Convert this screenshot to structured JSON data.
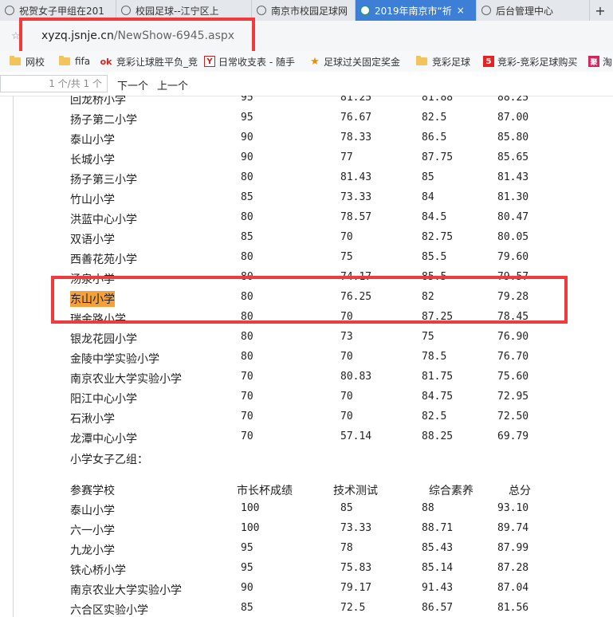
{
  "tabs": [
    {
      "label": "祝贺女子甲组在201",
      "active": false
    },
    {
      "label": "校园足球--江宁区上",
      "active": false
    },
    {
      "label": "南京市校园足球网",
      "active": false
    },
    {
      "label": "2019年南京市“祈",
      "active": true
    },
    {
      "label": "后台管理中心",
      "active": false
    }
  ],
  "new_tab_label": "+",
  "close_glyph": "×",
  "address": {
    "domain": "xyzq.jsnje.cn",
    "path": "/NewShow-6945.aspx"
  },
  "bookmarks": [
    {
      "label": "网校",
      "icon": "folder-icon"
    },
    {
      "label": "fifa",
      "icon": "folder-icon"
    },
    {
      "label": "竞彩让球胜平负_竞",
      "icon": "ok-icon"
    },
    {
      "label": "日常收支表 - 随手",
      "icon": "y-icon"
    },
    {
      "label": "足球过关固定奖金",
      "icon": "star-icon"
    },
    {
      "label": "竞彩足球",
      "icon": "folder-icon"
    },
    {
      "label": "竞彩-竞彩足球购买",
      "icon": "five-icon"
    },
    {
      "label": "淘",
      "icon": "ju-icon"
    }
  ],
  "bookmark_icon_glyphs": {
    "ok": "ok",
    "y": "Y",
    "star": "★",
    "five": "5",
    "ju": "聚"
  },
  "find": {
    "counter": "1 个/共 1 个",
    "next": "下一个",
    "prev": "上一个"
  },
  "rows_top": [
    {
      "school": "回龙桥小学",
      "a": "95",
      "b": "81.25",
      "c": "81.88",
      "d": "88.25"
    },
    {
      "school": "扬子第二小学",
      "a": "95",
      "b": "76.67",
      "c": "82.5",
      "d": "87.00"
    },
    {
      "school": "泰山小学",
      "a": "90",
      "b": "78.33",
      "c": "86.5",
      "d": "85.80"
    },
    {
      "school": "长城小学",
      "a": "90",
      "b": "77",
      "c": "87.75",
      "d": "85.65"
    },
    {
      "school": "扬子第三小学",
      "a": "80",
      "b": "81.43",
      "c": "85",
      "d": "81.43"
    },
    {
      "school": "竹山小学",
      "a": "85",
      "b": "73.33",
      "c": "84",
      "d": "81.30"
    },
    {
      "school": "洪蓝中心小学",
      "a": "80",
      "b": "78.57",
      "c": "84.5",
      "d": "80.47"
    },
    {
      "school": "双语小学",
      "a": "85",
      "b": "70",
      "c": "82.75",
      "d": "80.05"
    },
    {
      "school": "西善花苑小学",
      "a": "80",
      "b": "75",
      "c": "85.5",
      "d": "79.60"
    },
    {
      "school": "汤泉小学",
      "a": "80",
      "b": "74.17",
      "c": "85.5",
      "d": "79.57"
    },
    {
      "school": "东山小学",
      "a": "80",
      "b": "76.25",
      "c": "82",
      "d": "79.28"
    },
    {
      "school": "瑞金路小学",
      "a": "80",
      "b": "70",
      "c": "87.25",
      "d": "78.45"
    },
    {
      "school": "银龙花园小学",
      "a": "80",
      "b": "73",
      "c": "75",
      "d": "76.90"
    },
    {
      "school": "金陵中学实验小学",
      "a": "80",
      "b": "70",
      "c": "78.5",
      "d": "76.70"
    },
    {
      "school": "南京农业大学实验小学",
      "a": "70",
      "b": "80.83",
      "c": "81.75",
      "d": "75.60"
    },
    {
      "school": "阳江中心小学",
      "a": "70",
      "b": "70",
      "c": "84.75",
      "d": "72.95"
    },
    {
      "school": "石湫小学",
      "a": "70",
      "b": "70",
      "c": "82.5",
      "d": "72.50"
    },
    {
      "school": "龙潭中心小学",
      "a": "70",
      "b": "57.14",
      "c": "88.25",
      "d": "69.79"
    }
  ],
  "section_title": "小学女子乙组：",
  "headers": [
    "参赛学校",
    "市长杯成绩",
    "技术测试",
    "综合素养",
    "总分"
  ],
  "rows_bottom": [
    {
      "school": "泰山小学",
      "a": "100",
      "b": "85",
      "c": "88",
      "d": "93.10"
    },
    {
      "school": "六一小学",
      "a": "100",
      "b": "73.33",
      "c": "88.71",
      "d": "89.74"
    },
    {
      "school": "九龙小学",
      "a": "95",
      "b": "78",
      "c": "85.43",
      "d": "87.99"
    },
    {
      "school": "铁心桥小学",
      "a": "95",
      "b": "75.83",
      "c": "85.14",
      "d": "87.28"
    },
    {
      "school": "南京农业大学实验小学",
      "a": "90",
      "b": "79.17",
      "c": "91.43",
      "d": "87.04"
    },
    {
      "school": "六合区实验小学",
      "a": "85",
      "b": "72.5",
      "c": "86.57",
      "d": "81.56"
    }
  ],
  "highlight_color": "#ef3b3b",
  "search_mark_color": "#f5a03a",
  "active_tab_color": "#3d7fd6"
}
